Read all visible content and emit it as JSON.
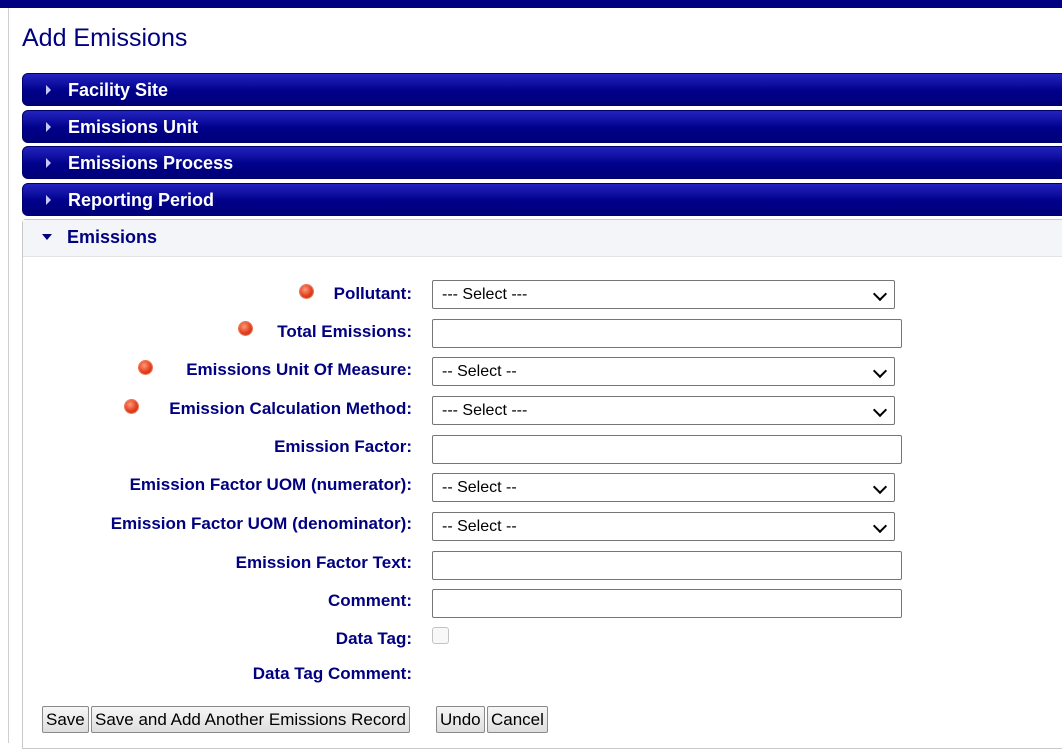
{
  "page": {
    "title": "Add Emissions"
  },
  "accordion": {
    "facility_site": "Facility Site",
    "emissions_unit": "Emissions Unit",
    "emissions_process": "Emissions Process",
    "reporting_period": "Reporting Period",
    "emissions": "Emissions"
  },
  "form": {
    "pollutant": {
      "label": "Pollutant:",
      "required": true,
      "value": "--- Select ---"
    },
    "total_emissions": {
      "label": "Total Emissions:",
      "required": true,
      "value": ""
    },
    "emissions_uom": {
      "label": "Emissions Unit Of Measure:",
      "required": true,
      "value": "-- Select --"
    },
    "calc_method": {
      "label": "Emission Calculation Method:",
      "required": true,
      "value": "--- Select ---"
    },
    "emission_factor": {
      "label": "Emission Factor:",
      "required": false,
      "value": ""
    },
    "ef_uom_numerator": {
      "label": "Emission Factor UOM (numerator):",
      "required": false,
      "value": "-- Select --"
    },
    "ef_uom_denominator": {
      "label": "Emission Factor UOM (denominator):",
      "required": false,
      "value": "-- Select --"
    },
    "ef_text": {
      "label": "Emission Factor Text:",
      "required": false,
      "value": ""
    },
    "comment": {
      "label": "Comment:",
      "required": false,
      "value": ""
    },
    "data_tag": {
      "label": "Data Tag:",
      "checked": false
    },
    "data_tag_comment": {
      "label": "Data Tag Comment:"
    }
  },
  "buttons": {
    "save": "Save",
    "save_add_another": "Save and Add Another Emissions Record",
    "undo": "Undo",
    "cancel": "Cancel"
  },
  "colors": {
    "nav": "#000080",
    "required_marker": "#e2401e"
  },
  "icons": {
    "collapsed": "caret-right-icon",
    "expanded": "caret-down-icon",
    "required": "required-dot-icon"
  }
}
